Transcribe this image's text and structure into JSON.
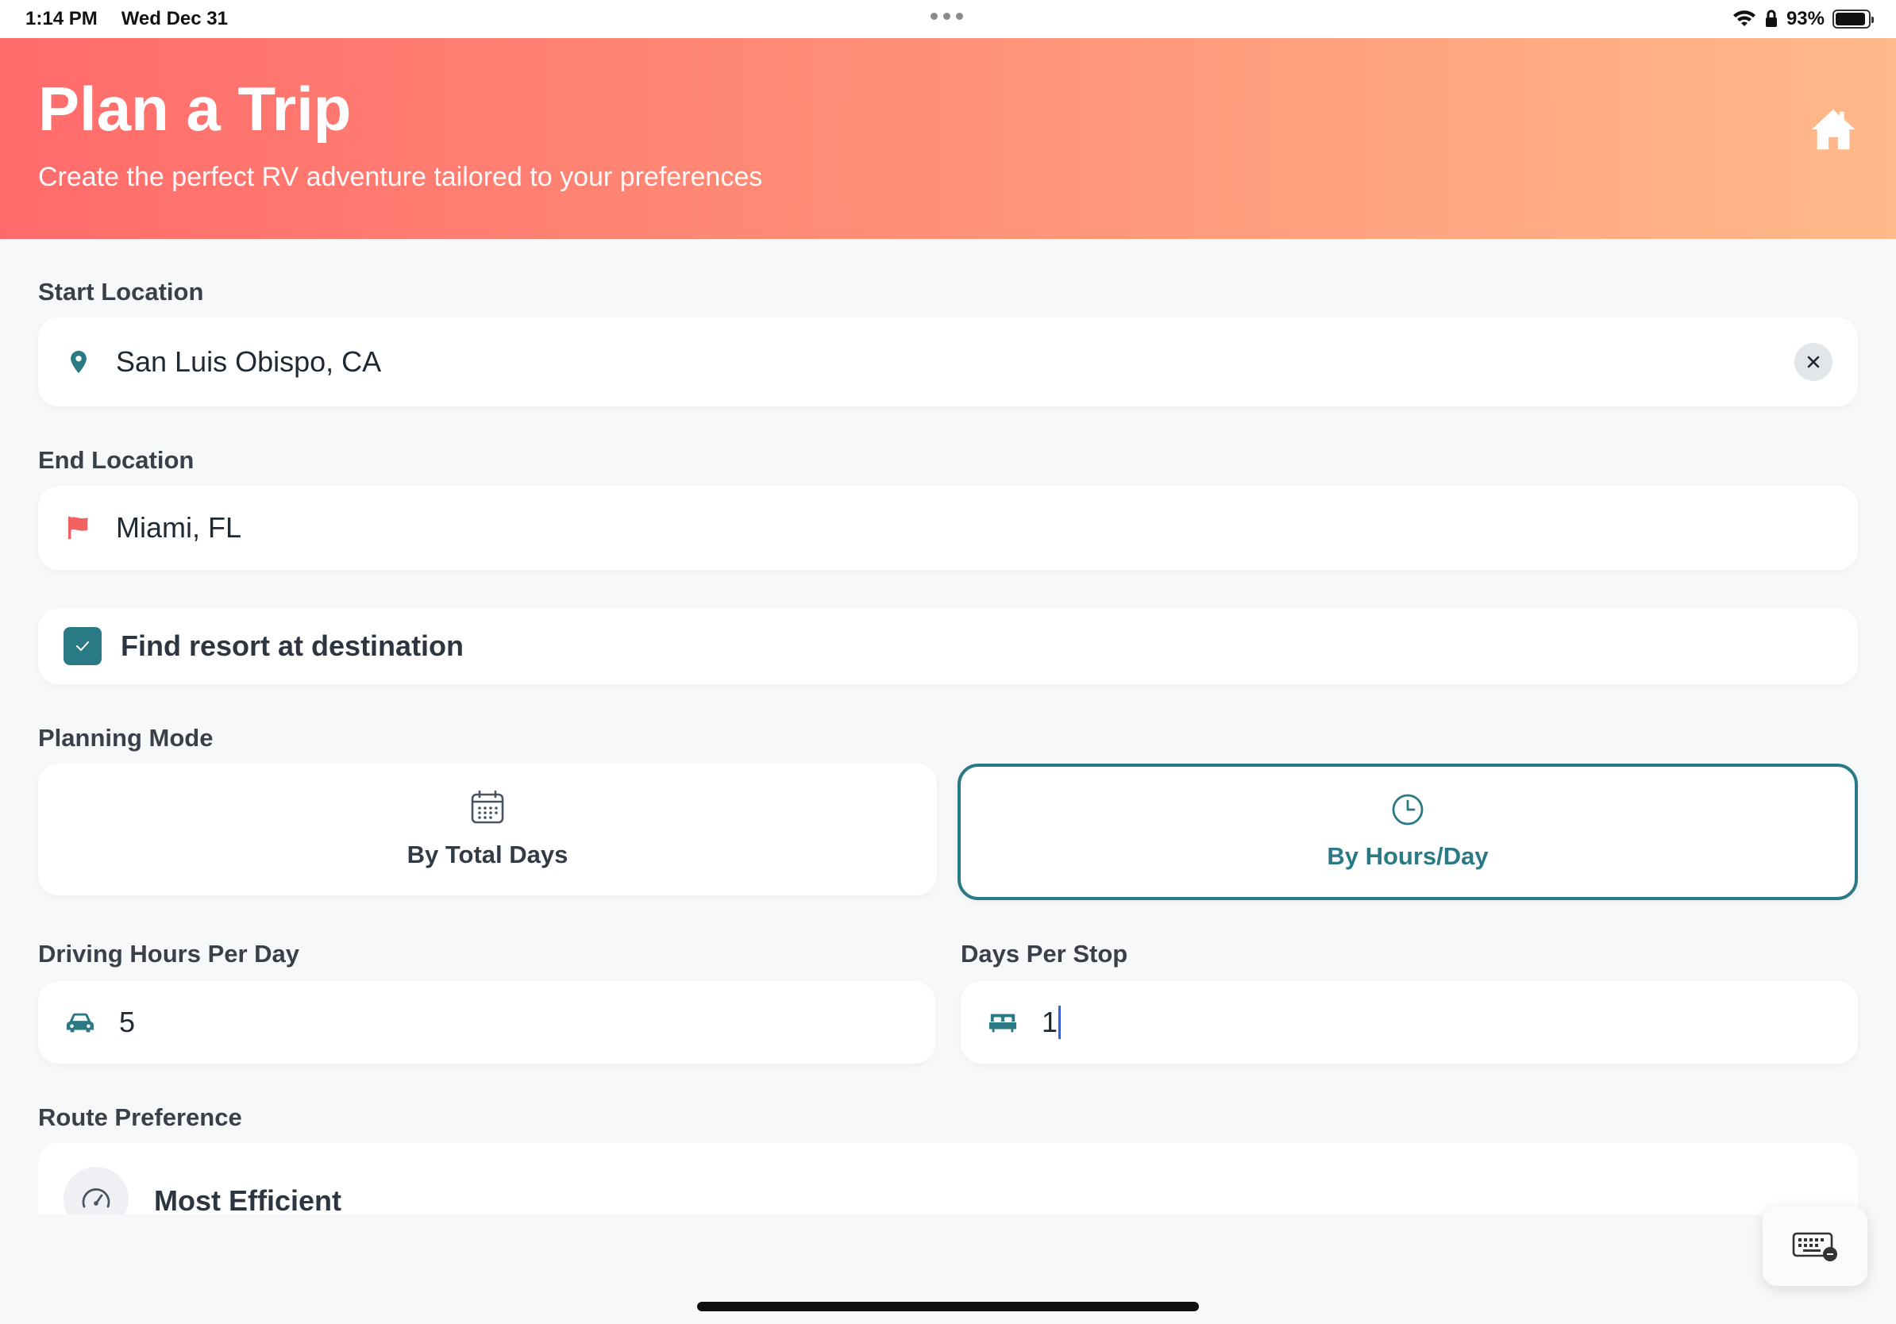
{
  "status_bar": {
    "time": "1:14 PM",
    "date": "Wed Dec 31",
    "battery": "93%"
  },
  "header": {
    "title": "Plan a Trip",
    "subtitle": "Create the perfect RV adventure tailored to your preferences",
    "home_icon": "home-icon"
  },
  "start_location": {
    "label": "Start Location",
    "value": "San Luis Obispo, CA",
    "icon": "map-pin-icon"
  },
  "end_location": {
    "label": "End Location",
    "value": "Miami, FL",
    "icon": "flag-icon"
  },
  "resort": {
    "label": "Find resort at destination",
    "checked": true
  },
  "planning_mode": {
    "label": "Planning Mode",
    "options": [
      {
        "label": "By Total Days",
        "icon": "calendar-icon",
        "selected": false
      },
      {
        "label": "By Hours/Day",
        "icon": "clock-icon",
        "selected": true
      }
    ]
  },
  "driving_hours": {
    "label": "Driving Hours Per Day",
    "value": "5",
    "icon": "car-icon"
  },
  "days_per_stop": {
    "label": "Days Per Stop",
    "value": "1",
    "icon": "bed-icon"
  },
  "route_preference": {
    "label": "Route Preference",
    "option": "Most Efficient",
    "icon": "speedometer-icon"
  },
  "colors": {
    "accent": "#2a7a85",
    "header_start": "#ff6b6b",
    "header_end": "#ffb98a",
    "flag": "#f26161"
  }
}
